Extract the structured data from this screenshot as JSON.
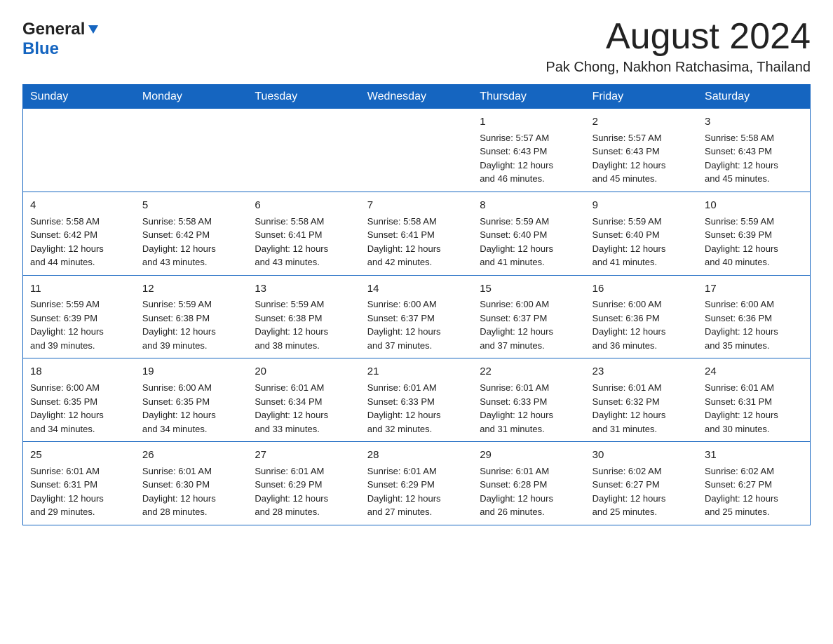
{
  "header": {
    "logo_general": "General",
    "logo_arrow": "▶",
    "logo_blue": "Blue",
    "title": "August 2024",
    "subtitle": "Pak Chong, Nakhon Ratchasima, Thailand"
  },
  "days_of_week": [
    "Sunday",
    "Monday",
    "Tuesday",
    "Wednesday",
    "Thursday",
    "Friday",
    "Saturday"
  ],
  "weeks": [
    [
      {
        "day": "",
        "info": ""
      },
      {
        "day": "",
        "info": ""
      },
      {
        "day": "",
        "info": ""
      },
      {
        "day": "",
        "info": ""
      },
      {
        "day": "1",
        "info": "Sunrise: 5:57 AM\nSunset: 6:43 PM\nDaylight: 12 hours\nand 46 minutes."
      },
      {
        "day": "2",
        "info": "Sunrise: 5:57 AM\nSunset: 6:43 PM\nDaylight: 12 hours\nand 45 minutes."
      },
      {
        "day": "3",
        "info": "Sunrise: 5:58 AM\nSunset: 6:43 PM\nDaylight: 12 hours\nand 45 minutes."
      }
    ],
    [
      {
        "day": "4",
        "info": "Sunrise: 5:58 AM\nSunset: 6:42 PM\nDaylight: 12 hours\nand 44 minutes."
      },
      {
        "day": "5",
        "info": "Sunrise: 5:58 AM\nSunset: 6:42 PM\nDaylight: 12 hours\nand 43 minutes."
      },
      {
        "day": "6",
        "info": "Sunrise: 5:58 AM\nSunset: 6:41 PM\nDaylight: 12 hours\nand 43 minutes."
      },
      {
        "day": "7",
        "info": "Sunrise: 5:58 AM\nSunset: 6:41 PM\nDaylight: 12 hours\nand 42 minutes."
      },
      {
        "day": "8",
        "info": "Sunrise: 5:59 AM\nSunset: 6:40 PM\nDaylight: 12 hours\nand 41 minutes."
      },
      {
        "day": "9",
        "info": "Sunrise: 5:59 AM\nSunset: 6:40 PM\nDaylight: 12 hours\nand 41 minutes."
      },
      {
        "day": "10",
        "info": "Sunrise: 5:59 AM\nSunset: 6:39 PM\nDaylight: 12 hours\nand 40 minutes."
      }
    ],
    [
      {
        "day": "11",
        "info": "Sunrise: 5:59 AM\nSunset: 6:39 PM\nDaylight: 12 hours\nand 39 minutes."
      },
      {
        "day": "12",
        "info": "Sunrise: 5:59 AM\nSunset: 6:38 PM\nDaylight: 12 hours\nand 39 minutes."
      },
      {
        "day": "13",
        "info": "Sunrise: 5:59 AM\nSunset: 6:38 PM\nDaylight: 12 hours\nand 38 minutes."
      },
      {
        "day": "14",
        "info": "Sunrise: 6:00 AM\nSunset: 6:37 PM\nDaylight: 12 hours\nand 37 minutes."
      },
      {
        "day": "15",
        "info": "Sunrise: 6:00 AM\nSunset: 6:37 PM\nDaylight: 12 hours\nand 37 minutes."
      },
      {
        "day": "16",
        "info": "Sunrise: 6:00 AM\nSunset: 6:36 PM\nDaylight: 12 hours\nand 36 minutes."
      },
      {
        "day": "17",
        "info": "Sunrise: 6:00 AM\nSunset: 6:36 PM\nDaylight: 12 hours\nand 35 minutes."
      }
    ],
    [
      {
        "day": "18",
        "info": "Sunrise: 6:00 AM\nSunset: 6:35 PM\nDaylight: 12 hours\nand 34 minutes."
      },
      {
        "day": "19",
        "info": "Sunrise: 6:00 AM\nSunset: 6:35 PM\nDaylight: 12 hours\nand 34 minutes."
      },
      {
        "day": "20",
        "info": "Sunrise: 6:01 AM\nSunset: 6:34 PM\nDaylight: 12 hours\nand 33 minutes."
      },
      {
        "day": "21",
        "info": "Sunrise: 6:01 AM\nSunset: 6:33 PM\nDaylight: 12 hours\nand 32 minutes."
      },
      {
        "day": "22",
        "info": "Sunrise: 6:01 AM\nSunset: 6:33 PM\nDaylight: 12 hours\nand 31 minutes."
      },
      {
        "day": "23",
        "info": "Sunrise: 6:01 AM\nSunset: 6:32 PM\nDaylight: 12 hours\nand 31 minutes."
      },
      {
        "day": "24",
        "info": "Sunrise: 6:01 AM\nSunset: 6:31 PM\nDaylight: 12 hours\nand 30 minutes."
      }
    ],
    [
      {
        "day": "25",
        "info": "Sunrise: 6:01 AM\nSunset: 6:31 PM\nDaylight: 12 hours\nand 29 minutes."
      },
      {
        "day": "26",
        "info": "Sunrise: 6:01 AM\nSunset: 6:30 PM\nDaylight: 12 hours\nand 28 minutes."
      },
      {
        "day": "27",
        "info": "Sunrise: 6:01 AM\nSunset: 6:29 PM\nDaylight: 12 hours\nand 28 minutes."
      },
      {
        "day": "28",
        "info": "Sunrise: 6:01 AM\nSunset: 6:29 PM\nDaylight: 12 hours\nand 27 minutes."
      },
      {
        "day": "29",
        "info": "Sunrise: 6:01 AM\nSunset: 6:28 PM\nDaylight: 12 hours\nand 26 minutes."
      },
      {
        "day": "30",
        "info": "Sunrise: 6:02 AM\nSunset: 6:27 PM\nDaylight: 12 hours\nand 25 minutes."
      },
      {
        "day": "31",
        "info": "Sunrise: 6:02 AM\nSunset: 6:27 PM\nDaylight: 12 hours\nand 25 minutes."
      }
    ]
  ]
}
